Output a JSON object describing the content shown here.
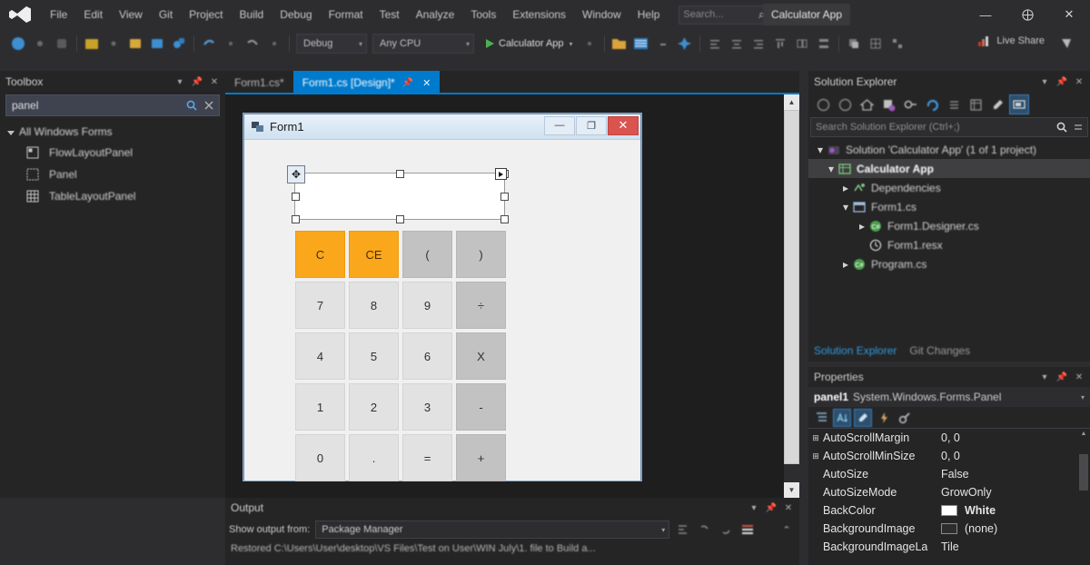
{
  "titlebar": {
    "menu": [
      "File",
      "Edit",
      "View",
      "Git",
      "Project",
      "Build",
      "Debug",
      "Format",
      "Test",
      "Analyze",
      "Tools",
      "Extensions",
      "Window",
      "Help"
    ],
    "search_placeholder": "Search...",
    "app_title": "Calculator App",
    "minimize": "—",
    "maximize": "＋",
    "close": "✕",
    "logo_icon": "visual-studio-logo"
  },
  "toolbar": {
    "config": "Debug",
    "platform": "Any CPU",
    "run_label": "Calculator App",
    "liveshare": "Live Share",
    "dropdown_arrow": "▾"
  },
  "toolbox": {
    "title": "Toolbox",
    "search_value": "panel",
    "group": "All Windows Forms",
    "items": [
      {
        "label": "FlowLayoutPanel"
      },
      {
        "label": "Panel"
      },
      {
        "label": "TableLayoutPanel"
      }
    ]
  },
  "tabs": [
    {
      "label": "Form1.cs*",
      "active": false
    },
    {
      "label": "Form1.cs [Design]*",
      "active": true
    }
  ],
  "designer": {
    "form_title": "Form1",
    "window_buttons": {
      "min": "—",
      "max": "❐",
      "close": "✕"
    },
    "selected_control": "panel1",
    "keypad": [
      [
        {
          "label": "C",
          "style": "orange"
        },
        {
          "label": "CE",
          "style": "orange"
        },
        {
          "label": "(",
          "style": "op"
        },
        {
          "label": ")",
          "style": "op"
        }
      ],
      [
        {
          "label": "7",
          "style": "num"
        },
        {
          "label": "8",
          "style": "num"
        },
        {
          "label": "9",
          "style": "num"
        },
        {
          "label": "÷",
          "style": "op"
        }
      ],
      [
        {
          "label": "4",
          "style": "num"
        },
        {
          "label": "5",
          "style": "num"
        },
        {
          "label": "6",
          "style": "num"
        },
        {
          "label": "X",
          "style": "op"
        }
      ],
      [
        {
          "label": "1",
          "style": "num"
        },
        {
          "label": "2",
          "style": "num"
        },
        {
          "label": "3",
          "style": "num"
        },
        {
          "label": "-",
          "style": "op"
        }
      ],
      [
        {
          "label": "0",
          "style": "num"
        },
        {
          "label": ".",
          "style": "num"
        },
        {
          "label": "=",
          "style": "num"
        },
        {
          "label": "+",
          "style": "op"
        }
      ]
    ]
  },
  "output": {
    "title": "Output",
    "show_label": "Show output from:",
    "source": "Package Manager",
    "line": "Restored C:\\Users\\User\\desktop\\VS Files\\Test on User\\WIN July\\1. file to Build a..."
  },
  "solution_explorer": {
    "title": "Solution Explorer",
    "search_placeholder": "Search Solution Explorer (Ctrl+;)",
    "tree": [
      {
        "label": "Solution 'Calculator App' (1 of 1 project)",
        "indent": 0,
        "expander": "▾",
        "icon": "solution-icon",
        "selected": false
      },
      {
        "label": "Calculator App",
        "indent": 1,
        "expander": "▾",
        "icon": "project-icon",
        "selected": true
      },
      {
        "label": "Dependencies",
        "indent": 2,
        "expander": "▸",
        "icon": "dependencies-icon",
        "selected": false
      },
      {
        "label": "Form1.cs",
        "indent": 2,
        "expander": "▾",
        "icon": "form-icon",
        "selected": false
      },
      {
        "label": "Form1.Designer.cs",
        "indent": 3,
        "expander": "▸",
        "icon": "csharp-icon",
        "selected": false
      },
      {
        "label": "Form1.resx",
        "indent": 3,
        "expander": "",
        "icon": "resx-icon",
        "selected": false
      },
      {
        "label": "Program.cs",
        "indent": 2,
        "expander": "▸",
        "icon": "csharp-icon",
        "selected": false
      }
    ],
    "bottom_tabs": [
      {
        "label": "Solution Explorer",
        "active": true
      },
      {
        "label": "Git Changes",
        "active": false
      }
    ]
  },
  "properties": {
    "title": "Properties",
    "object_name": "panel1",
    "object_type": "System.Windows.Forms.Panel",
    "rows": [
      {
        "expander": "⊞",
        "name": "AutoScrollMargin",
        "value": "0, 0",
        "swatch": ""
      },
      {
        "expander": "⊞",
        "name": "AutoScrollMinSize",
        "value": "0, 0",
        "swatch": ""
      },
      {
        "expander": "",
        "name": "AutoSize",
        "value": "False",
        "swatch": ""
      },
      {
        "expander": "",
        "name": "AutoSizeMode",
        "value": "GrowOnly",
        "swatch": ""
      },
      {
        "expander": "",
        "name": "BackColor",
        "value": "White",
        "swatch": "#ffffff",
        "bold": true
      },
      {
        "expander": "",
        "name": "BackgroundImage",
        "value": "(none)",
        "swatch": "#2d2d30"
      },
      {
        "expander": "",
        "name": "BackgroundImageLa",
        "value": "Tile",
        "swatch": ""
      }
    ]
  },
  "colors": {
    "accent": "#007acc",
    "chrome": "#2d2d30",
    "panel": "#252526",
    "orange_key": "#fba71b",
    "close_red": "#d9534f"
  }
}
